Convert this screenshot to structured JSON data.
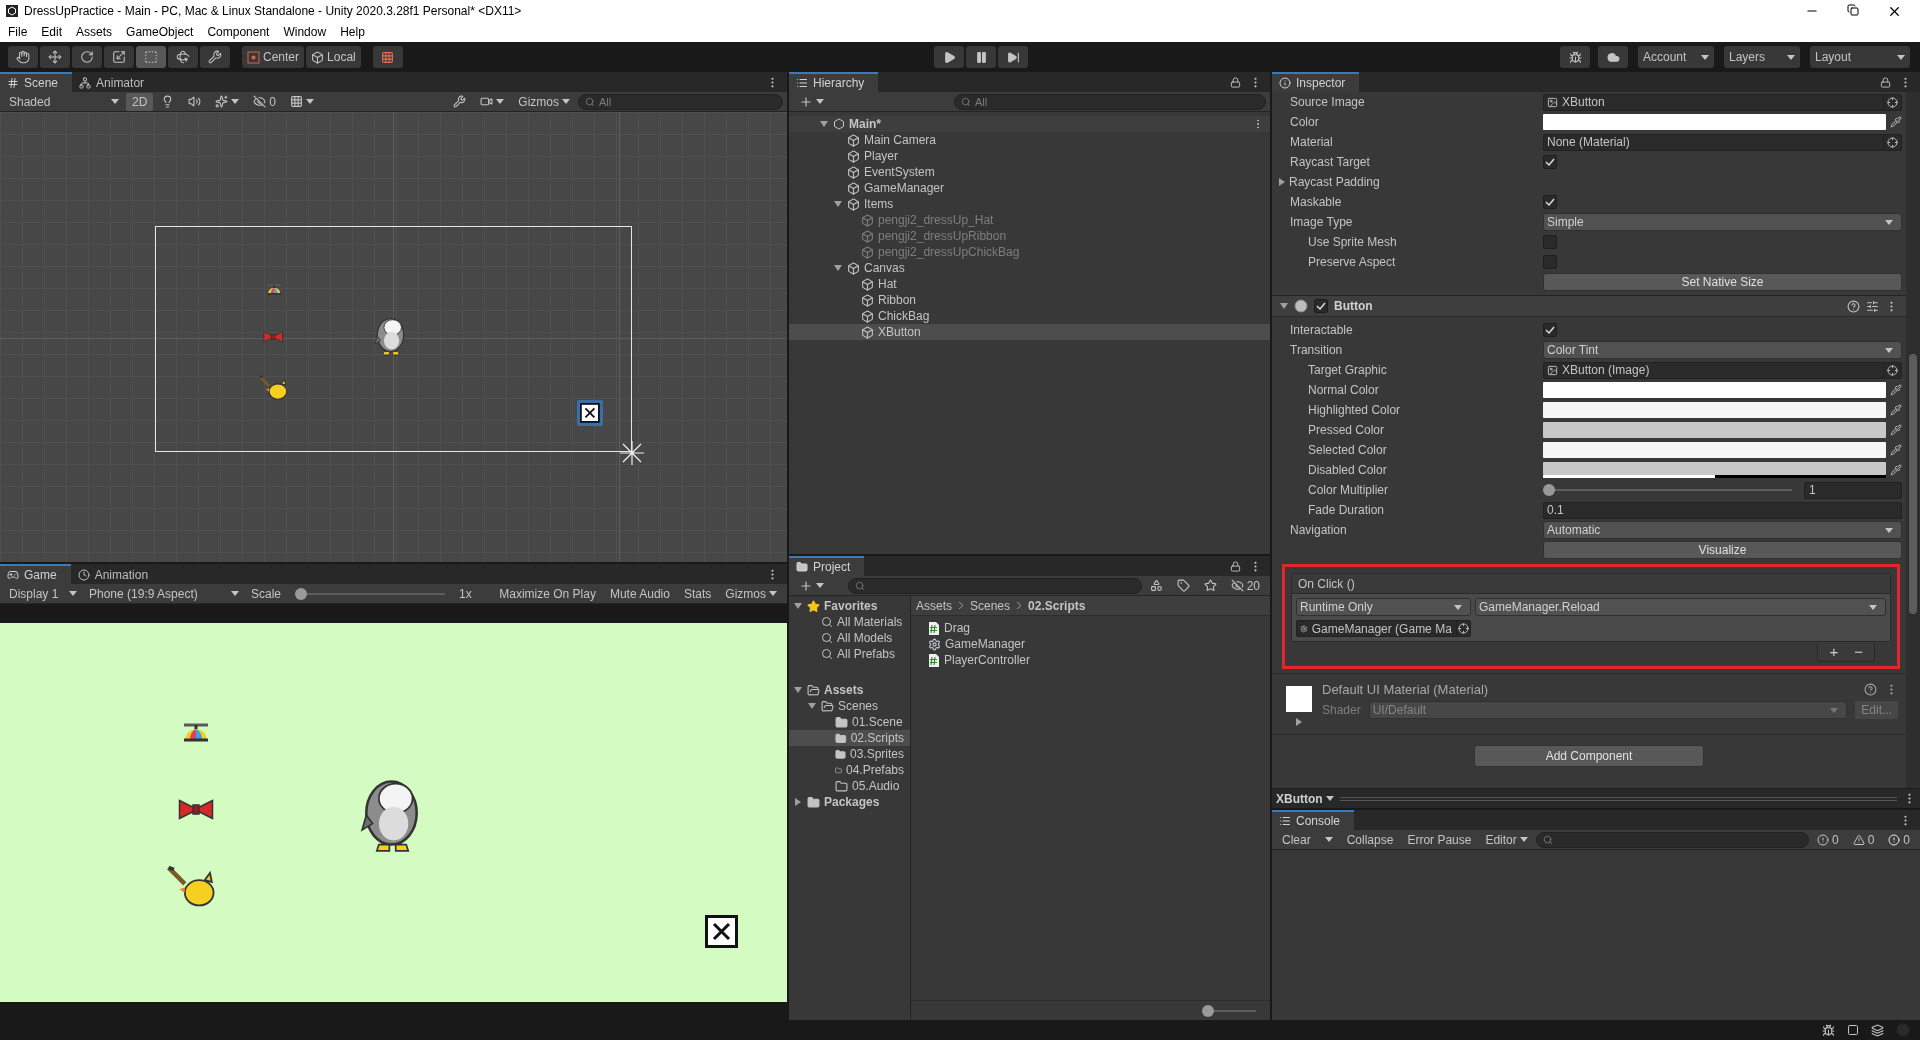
{
  "window": {
    "title": "DressUpPractice - Main - PC, Mac & Linux Standalone - Unity 2020.3.28f1 Personal* <DX11>"
  },
  "menu": [
    "File",
    "Edit",
    "Assets",
    "GameObject",
    "Component",
    "Window",
    "Help"
  ],
  "toolbar": {
    "tools": [
      {
        "kind": "hand",
        "selected": false
      },
      {
        "kind": "move",
        "selected": false
      },
      {
        "kind": "rotate",
        "selected": false
      },
      {
        "kind": "scale",
        "selected": false
      },
      {
        "kind": "rect",
        "selected": true
      },
      {
        "kind": "transform",
        "selected": false
      },
      {
        "kind": "custom",
        "selected": false
      }
    ],
    "pivot": [
      "Center",
      "Local"
    ],
    "menus": [
      "Account",
      "Layers",
      "Layout"
    ]
  },
  "scene_panel": {
    "tabs": [
      {
        "label": "Scene",
        "kind": "scene",
        "selected": true
      },
      {
        "label": "Animator",
        "kind": "animator",
        "selected": false
      }
    ],
    "shading": "Shaded",
    "mode_2d": {
      "label": "2D",
      "on": true
    },
    "hidden_count": "0",
    "gizmos": "Gizmos",
    "search": {
      "placeholder": "All"
    }
  },
  "game_panel": {
    "tabs": [
      {
        "label": "Game",
        "kind": "game",
        "selected": true
      },
      {
        "label": "Animation",
        "kind": "animation",
        "selected": false
      }
    ],
    "display": "Display 1",
    "aspect": "Phone (19:9 Aspect)",
    "scale": {
      "label": "Scale",
      "level": 0,
      "reading": "1x"
    },
    "toggles": [
      {
        "label": "Maximize On Play",
        "on": false
      },
      {
        "label": "Mute Audio",
        "on": false
      },
      {
        "label": "Stats",
        "on": false
      },
      {
        "label": "Gizmos",
        "on": false
      }
    ]
  },
  "hierarchy": {
    "title": "Hierarchy",
    "search": {
      "placeholder": "All"
    },
    "scene": {
      "label": "Main*",
      "expanded": true,
      "children": [
        {
          "label": "Main Camera",
          "active": true,
          "selected": false
        },
        {
          "label": "Player",
          "active": true,
          "selected": false
        },
        {
          "label": "EventSystem",
          "active": true,
          "selected": false
        },
        {
          "label": "GameManager",
          "active": true,
          "selected": false
        },
        {
          "label": "Items",
          "active": true,
          "selected": false,
          "expanded": true,
          "children": [
            {
              "label": "pengji2_dressUp_Hat",
              "active": false,
              "selected": false
            },
            {
              "label": "pengji2_dressUpRibbon",
              "active": false,
              "selected": false
            },
            {
              "label": "pengji2_dressUpChickBag",
              "active": false,
              "selected": false
            }
          ]
        },
        {
          "label": "Canvas",
          "active": true,
          "selected": false,
          "expanded": true,
          "children": [
            {
              "label": "Hat",
              "active": true,
              "selected": false
            },
            {
              "label": "Ribbon",
              "active": true,
              "selected": false
            },
            {
              "label": "ChickBag",
              "active": true,
              "selected": false
            },
            {
              "label": "XButton",
              "active": true,
              "selected": true
            }
          ]
        }
      ]
    }
  },
  "project": {
    "title": "Project",
    "hidden_count": "20",
    "tree": [
      {
        "label": "Favorites",
        "kind": "star",
        "selected": false,
        "expanded": true,
        "children": [
          {
            "label": "All Materials",
            "kind": "search",
            "selected": false
          },
          {
            "label": "All Models",
            "kind": "search",
            "selected": false
          },
          {
            "label": "All Prefabs",
            "kind": "search",
            "selected": false
          }
        ]
      },
      {
        "label": "Assets",
        "kind": "open_folder",
        "selected": false,
        "expanded": true,
        "children": [
          {
            "label": "Scenes",
            "kind": "open_folder",
            "selected": false,
            "expanded": true,
            "children": [
              {
                "label": "01.Scene",
                "kind": "folder",
                "selected": false
              },
              {
                "label": "02.Scripts",
                "kind": "folder",
                "selected": true
              },
              {
                "label": "03.Sprites",
                "kind": "folder",
                "selected": false
              },
              {
                "label": "04.Prefabs",
                "kind": "empty_folder",
                "selected": false
              },
              {
                "label": "05.Audio",
                "kind": "empty_folder",
                "selected": false
              }
            ]
          }
        ]
      },
      {
        "label": "Packages",
        "kind": "folder",
        "selected": false,
        "expanded": false
      }
    ],
    "breadcrumbs": [
      "Assets",
      "Scenes",
      "02.Scripts"
    ],
    "files": [
      {
        "label": "Drag",
        "kind": "script"
      },
      {
        "label": "GameManager",
        "kind": "manager"
      },
      {
        "label": "PlayerController",
        "kind": "script"
      }
    ],
    "zoom": {
      "level": 0
    }
  },
  "inspector": {
    "title": "Inspector",
    "image_rows": [
      {
        "label": "Source Image",
        "kind": "image_ref",
        "value": "XButton"
      },
      {
        "label": "Color",
        "kind": "color",
        "color": "#ffffff"
      },
      {
        "label": "Material",
        "kind": "object",
        "value": "None (Material)"
      },
      {
        "label": "Raycast Target",
        "kind": "checkbox",
        "checked": true
      },
      {
        "label": "Raycast Padding",
        "kind": "foldout",
        "expanded": false
      },
      {
        "label": "Maskable",
        "kind": "checkbox",
        "checked": true
      },
      {
        "label": "Image Type",
        "kind": "dropdown",
        "value": "Simple",
        "children": [
          {
            "label": "Use Sprite Mesh",
            "kind": "checkbox",
            "checked": false
          },
          {
            "label": "Preserve Aspect",
            "kind": "checkbox",
            "checked": false
          }
        ]
      },
      {
        "kind": "button",
        "value": "Set Native Size"
      }
    ],
    "component": {
      "title": "Button",
      "enabled": true,
      "expanded": true,
      "rows": [
        {
          "label": "Interactable",
          "kind": "checkbox",
          "checked": true
        },
        {
          "label": "Transition",
          "kind": "dropdown",
          "value": "Color Tint",
          "children": [
            {
              "label": "Target Graphic",
              "kind": "image_ref",
              "value": "XButton (Image)"
            },
            {
              "label": "Normal Color",
              "kind": "color",
              "color": "#ffffff"
            },
            {
              "label": "Highlighted Color",
              "kind": "color",
              "color": "#f5f5f5"
            },
            {
              "label": "Pressed Color",
              "kind": "color",
              "color": "#c8c8c8"
            },
            {
              "label": "Selected Color",
              "kind": "color",
              "color": "#f5f5f5"
            },
            {
              "label": "Disabled Color",
              "kind": "color",
              "color": "#c8c8c8",
              "level": 0.5
            },
            {
              "label": "Color Multiplier",
              "kind": "slider",
              "level": 0,
              "reading": "1"
            },
            {
              "label": "Fade Duration",
              "kind": "number",
              "value": "0.1"
            }
          ]
        },
        {
          "label": "Navigation",
          "kind": "dropdown",
          "value": "Automatic"
        },
        {
          "kind": "button",
          "value": "Visualize"
        }
      ]
    },
    "on_click": {
      "title": "On Click ()",
      "highlighted": true,
      "mode": "Runtime Only",
      "function": "GameManager.Reload",
      "target": "GameManager (Game Ma",
      "add": "+",
      "remove": "−"
    },
    "material": {
      "title": "Default UI Material (Material)",
      "shader_label": "Shader",
      "shader": "UI/Default",
      "edit": "Edit...",
      "expanded": false
    },
    "add_component": "Add Component",
    "selection": "XButton"
  },
  "console": {
    "title": "Console",
    "clear": "Clear",
    "buttons": [
      {
        "label": "Collapse",
        "on": false
      },
      {
        "label": "Error Pause",
        "on": false
      }
    ],
    "target": "Editor",
    "counts": [
      {
        "kind": "info",
        "value": "0"
      },
      {
        "kind": "warning",
        "value": "0"
      },
      {
        "kind": "error",
        "value": "0"
      }
    ]
  }
}
